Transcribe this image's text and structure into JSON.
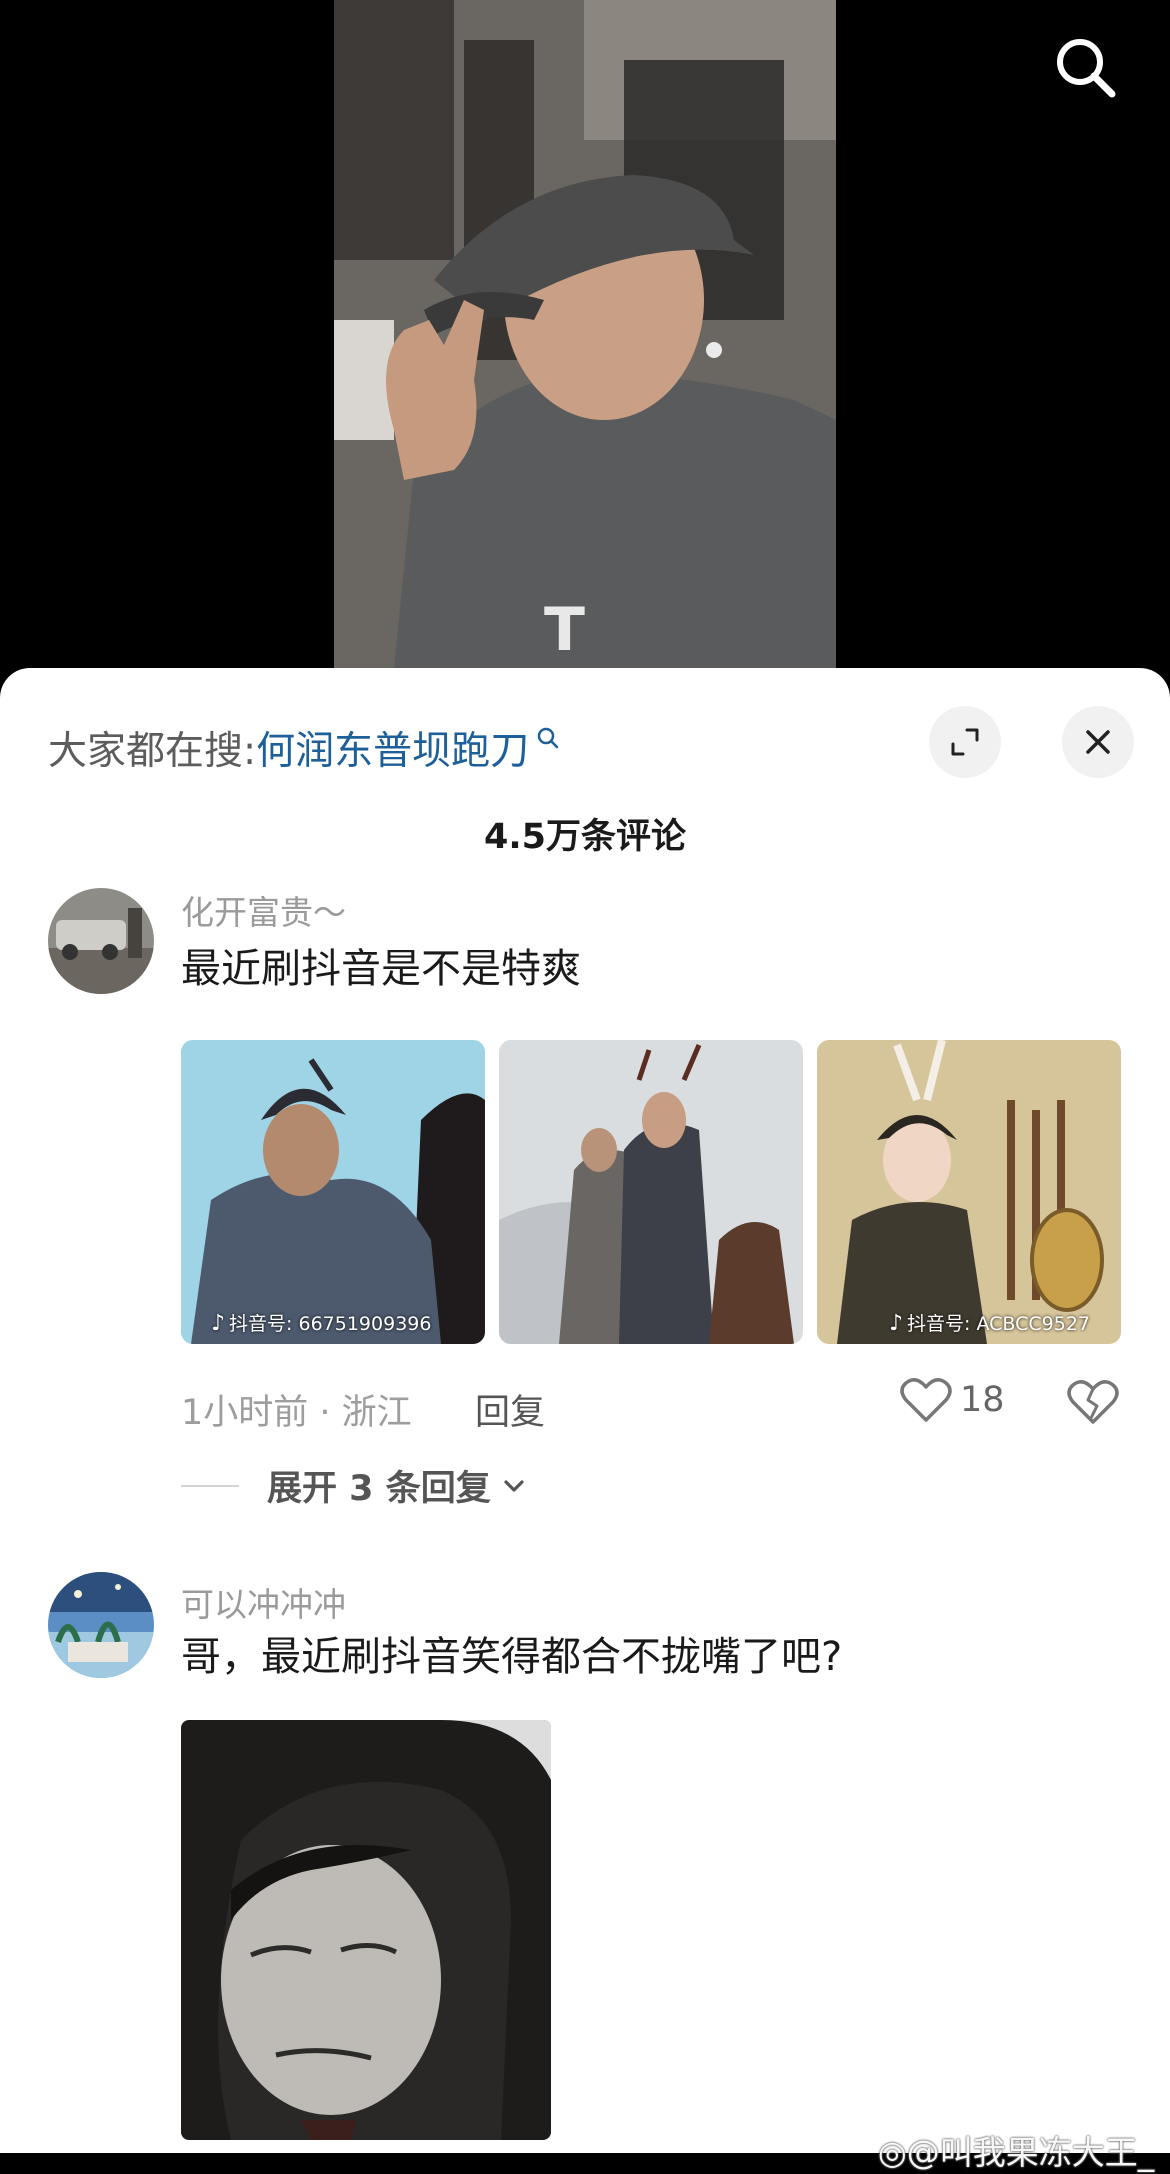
{
  "top_bar": {
    "search_icon": "search-icon"
  },
  "sheet": {
    "trending_label": "大家都在搜:",
    "trending_term": "何润东普坝跑刀",
    "expand_icon": "expand-icon",
    "close_icon": "close-icon",
    "comment_count": "4.5万条评论"
  },
  "comments": [
    {
      "username": "化开富贵〜",
      "text": "最近刷抖音是不是特爽",
      "images": [
        {
          "watermark": "抖音号: 66751909396"
        },
        {
          "watermark": ""
        },
        {
          "watermark": "抖音号: ACBCC9527"
        }
      ],
      "time_location": "1小时前 · 浙江",
      "reply_label": "回复",
      "like_count": "18",
      "expand_label": "展开 3 条回复"
    },
    {
      "username": "可以冲冲冲",
      "text": "哥，最近刷抖音笑得都合不拢嘴了吧?"
    }
  ],
  "watermark": "@叫我果冻大王_",
  "colors": {
    "trending_term": "#1d5f98",
    "sheet_bg": "#ffffff",
    "video_bg": "#000000"
  }
}
